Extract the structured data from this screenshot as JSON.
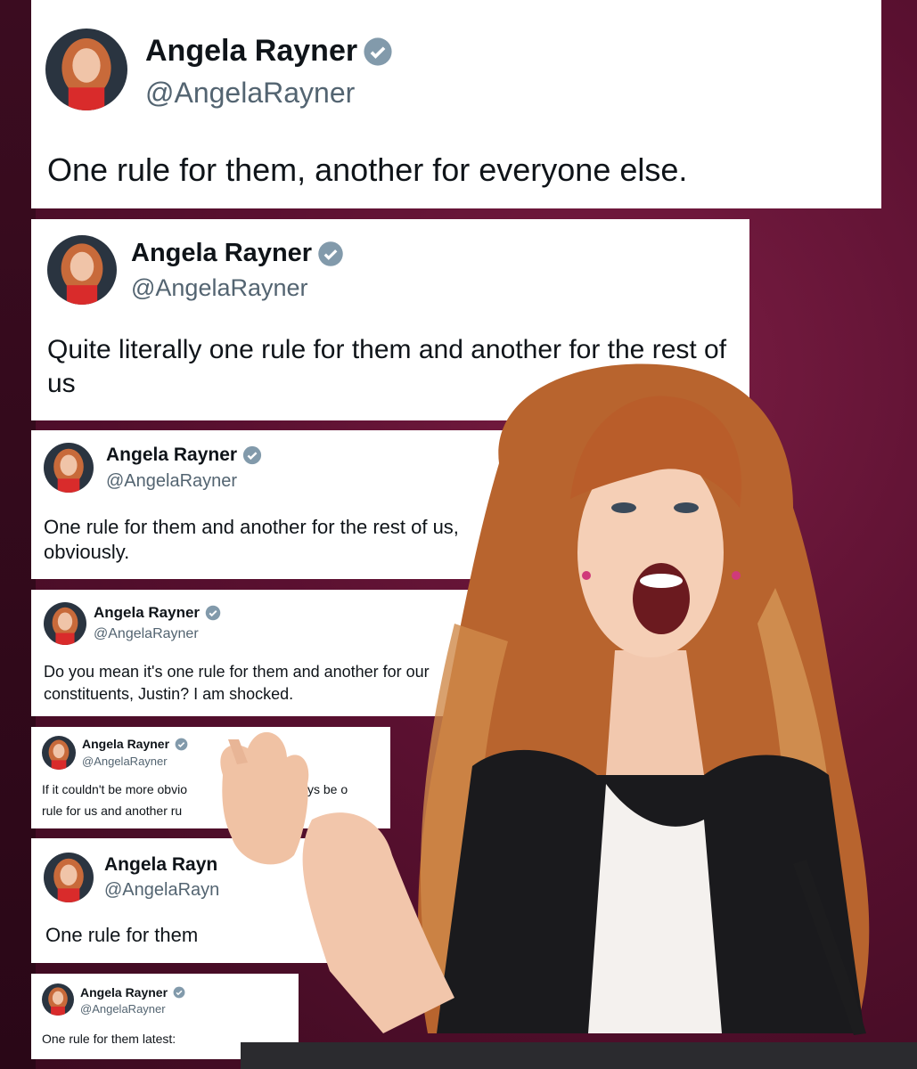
{
  "tweets": [
    {
      "name": "Angela Rayner",
      "handle": "@AngelaRayner",
      "text": "One rule for them, another for everyone else."
    },
    {
      "name": "Angela Rayner",
      "handle": "@AngelaRayner",
      "text": "Quite literally one rule for them and another for the rest of us"
    },
    {
      "name": "Angela Rayner",
      "handle": "@AngelaRayner",
      "text": "One rule for them and another for the rest of us, obviously."
    },
    {
      "name": "Angela Rayner",
      "handle": "@AngelaRayner",
      "text": "Do you mean it's one rule for them and another for our constituents, Justin? I am shocked."
    },
    {
      "name": "Angela Rayner",
      "handle": "@AngelaRayner",
      "text_line1": "If it couldn't be more obvio",
      "text_line1b": "ys be o",
      "text_line2": "rule for us and another ru"
    },
    {
      "name": "Angela Rayn",
      "handle": "@AngelaRayn",
      "text": "One rule for them"
    },
    {
      "name": "Angela Rayner",
      "handle": "@AngelaRayner",
      "text": "One rule for them latest:"
    }
  ],
  "icons": {
    "badge": "verified-badge-icon",
    "avatar": "profile-avatar",
    "photo": "woman-shouting-photo"
  },
  "colors": {
    "badge": "#829aab",
    "background": "#5a1030",
    "handle": "#536471"
  }
}
